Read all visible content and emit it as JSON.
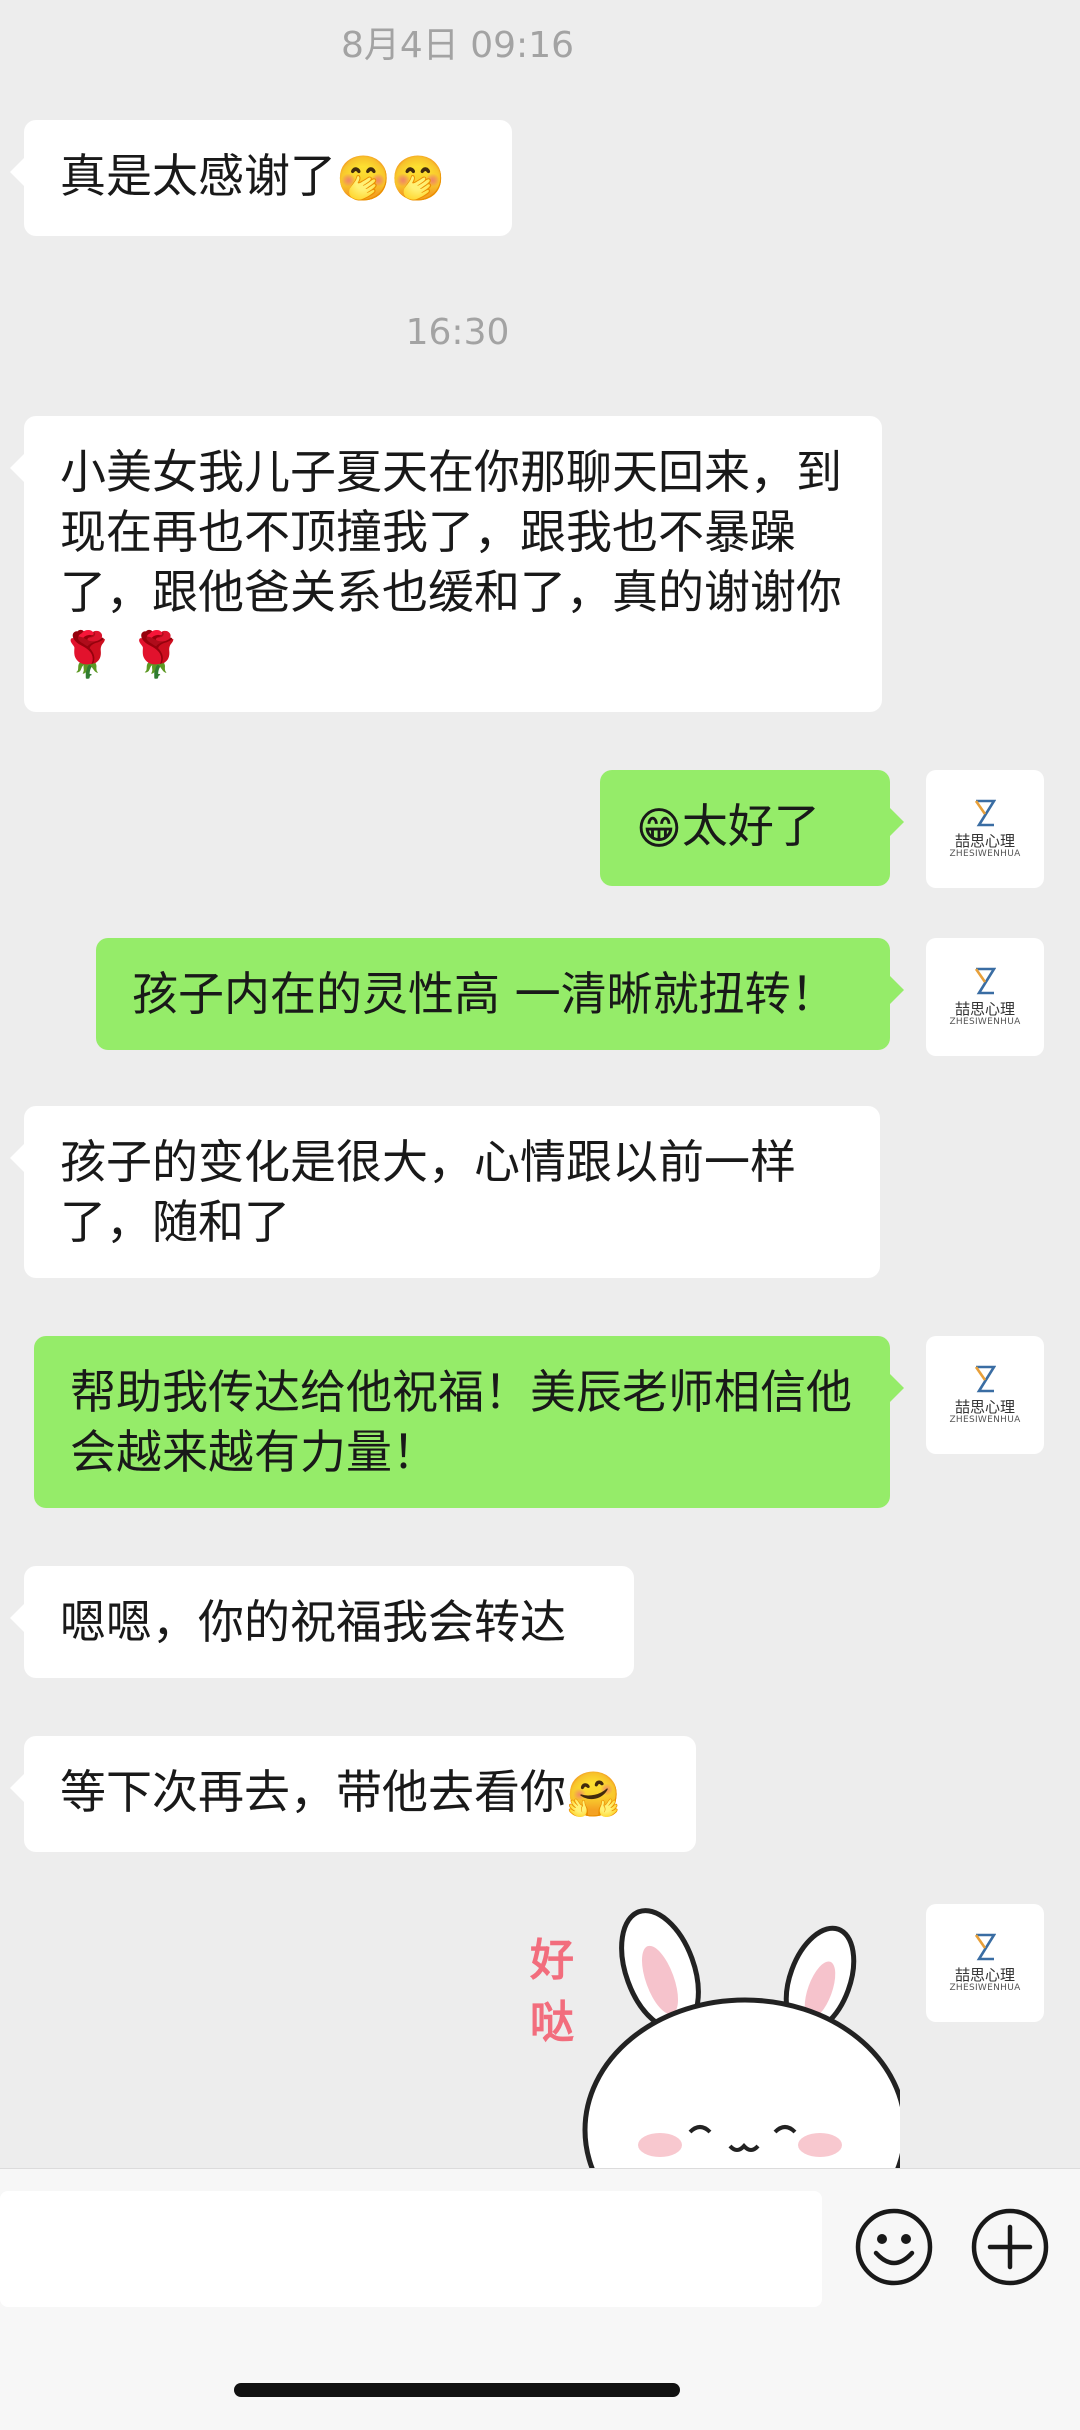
{
  "chat": {
    "timestamps": [
      "8月4日 09:16",
      "16:30"
    ],
    "messages": [
      {
        "side": "left",
        "text": "真是太感谢了",
        "emoji": "🤭🤭"
      },
      {
        "side": "left",
        "text": "小美女我儿子夏天在你那聊天回来，到现在再也不顶撞我了，跟我也不暴躁了，跟他爸关系也缓和了，真的谢谢你",
        "emoji": "🌹 🌹"
      },
      {
        "side": "right",
        "emoji": "😁",
        "text": "太好了"
      },
      {
        "side": "right",
        "text": "孩子内在的灵性高 一清晰就扭转！"
      },
      {
        "side": "left",
        "text": "孩子的变化是很大，心情跟以前一样了，随和了"
      },
      {
        "side": "right",
        "text": "帮助我传达给他祝福！美辰老师相信他会越来越有力量！"
      },
      {
        "side": "left",
        "text": "嗯嗯，你的祝福我会转达"
      },
      {
        "side": "left",
        "text": "等下次再去，带他去看你",
        "emoji": "🤗"
      }
    ],
    "sticker": {
      "text": "好哒",
      "icon": "bunny-sticker"
    }
  },
  "avatar": {
    "name_cn": "喆思心理",
    "name_en": "ZHESIWENHUA",
    "icon": "hourglass-logo"
  },
  "input_bar": {
    "placeholder": "",
    "emoji_icon": "smiley-face-icon",
    "plus_icon": "plus-circle-icon"
  },
  "colors": {
    "background": "#ededed",
    "bubble_left": "#ffffff",
    "bubble_right": "#95ec69",
    "timestamp": "#a3a3a3"
  }
}
